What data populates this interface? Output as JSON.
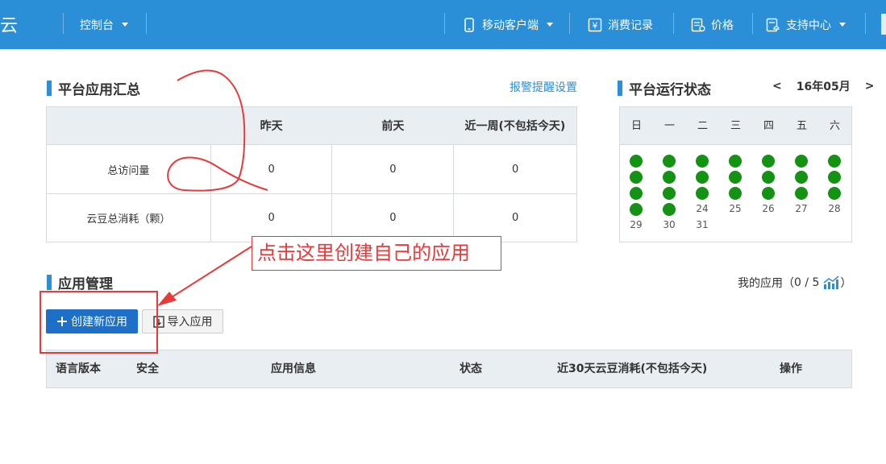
{
  "topbar": {
    "logo_text": "星云",
    "console_label": "控制台",
    "mobile_label": "移动客户端",
    "billing_label": "消费记录",
    "price_label": "价格",
    "support_label": "支持中心",
    "color": "#2a8fd7"
  },
  "summary": {
    "title": "平台应用汇总",
    "alert_link": "报警提醒设置",
    "columns": [
      "",
      "昨天",
      "前天",
      "近一周(不包括今天)"
    ],
    "rows": [
      {
        "label": "总访问量",
        "values": [
          "0",
          "0",
          "0"
        ]
      },
      {
        "label": "云豆总消耗（颗）",
        "values": [
          "0",
          "0",
          "0"
        ]
      }
    ]
  },
  "status": {
    "title": "平台运行状态",
    "prev": "<",
    "month": "16年05月",
    "next": ">",
    "weekdays": [
      "日",
      "一",
      "二",
      "三",
      "四",
      "五",
      "六"
    ],
    "day_29": "29",
    "day_30": "30",
    "day_31": "31",
    "day_24": "24",
    "day_25": "25",
    "day_26": "26",
    "day_27": "27",
    "day_28": "28",
    "dot_color": "#139213"
  },
  "apps": {
    "title": "应用管理",
    "create_label": "创建新应用",
    "import_label": "导入应用",
    "my_apps_label": "我的应用（",
    "my_apps_count": "0 / 5",
    "my_apps_close": "）",
    "columns": {
      "lang": "语言版本",
      "security": "安全",
      "info": "应用信息",
      "status": "状态",
      "usage": "近30天云豆消耗(不包括今天)",
      "action": "操作"
    }
  },
  "annotation": {
    "callout_text": "点击这里创建自己的应用",
    "color": "#e83a3a"
  }
}
